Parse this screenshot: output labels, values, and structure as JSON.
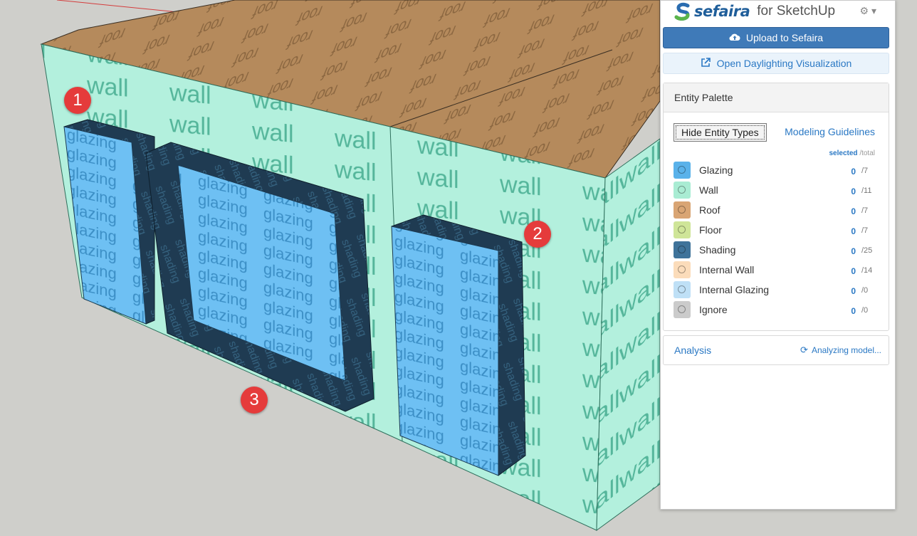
{
  "scene": {
    "markers": [
      "1",
      "2",
      "3"
    ],
    "wall_texture_text": "wall",
    "glazing_texture_text": "glazing",
    "shading_texture_text": "shading",
    "roof_texture_text": "roof"
  },
  "panel": {
    "brand": {
      "name": "sefaira",
      "subtitle": "for SketchUp"
    },
    "settings_icon": "gear-icon",
    "upload_label": "Upload to Sefaira",
    "daylight_label": "Open Daylighting Visualization",
    "entity_palette": {
      "title": "Entity Palette",
      "hide_button": "Hide Entity Types",
      "guidelines_link": "Modeling Guidelines",
      "col_selected": "selected",
      "col_total": "/total",
      "entities": [
        {
          "label": "Glazing",
          "selected": "0",
          "total": "/7",
          "color": "#5ab2ea"
        },
        {
          "label": "Wall",
          "selected": "0",
          "total": "/11",
          "color": "#a9ecd3"
        },
        {
          "label": "Roof",
          "selected": "0",
          "total": "/7",
          "color": "#d9a574"
        },
        {
          "label": "Floor",
          "selected": "0",
          "total": "/7",
          "color": "#cfe598"
        },
        {
          "label": "Shading",
          "selected": "0",
          "total": "/25",
          "color": "#3f739a"
        },
        {
          "label": "Internal Wall",
          "selected": "0",
          "total": "/14",
          "color": "#fbdcba"
        },
        {
          "label": "Internal Glazing",
          "selected": "0",
          "total": "/0",
          "color": "#bfe0f6"
        },
        {
          "label": "Ignore",
          "selected": "0",
          "total": "/0",
          "color": "#cbcbcb"
        }
      ]
    },
    "analysis": {
      "label": "Analysis",
      "status": "Analyzing model..."
    }
  }
}
